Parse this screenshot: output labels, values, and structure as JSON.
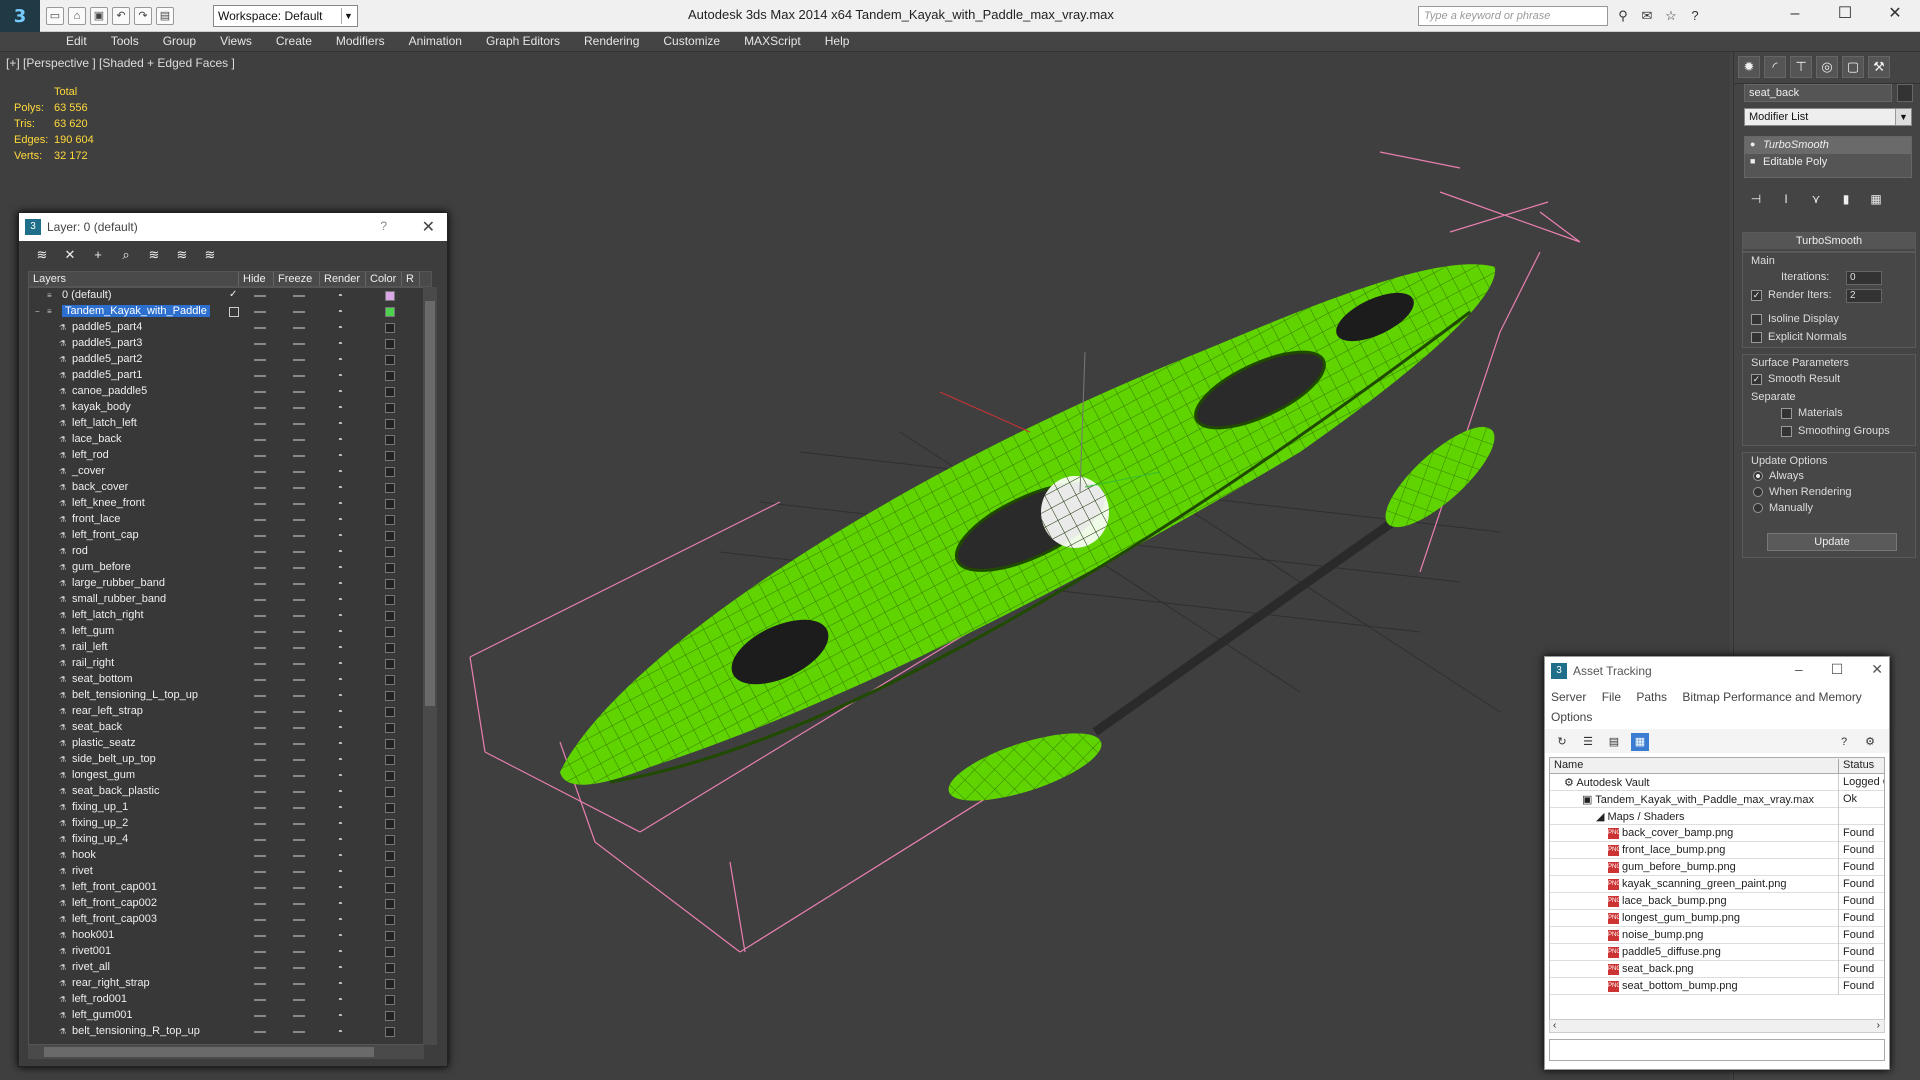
{
  "app": {
    "title": "Autodesk 3ds Max  2014 x64      Tandem_Kayak_with_Paddle_max_vray.max",
    "workspace": "Workspace: Default",
    "search_placeholder": "Type a keyword or phrase"
  },
  "menu": [
    "Edit",
    "Tools",
    "Group",
    "Views",
    "Create",
    "Modifiers",
    "Animation",
    "Graph Editors",
    "Rendering",
    "Customize",
    "MAXScript",
    "Help"
  ],
  "viewport": {
    "label": "[+] [Perspective ] [Shaded + Edged Faces ]",
    "stats": {
      "header": "Total",
      "rows": [
        {
          "label": "Polys:",
          "value": "63 556"
        },
        {
          "label": "Tris:",
          "value": "63 620"
        },
        {
          "label": "Edges:",
          "value": "190 604"
        },
        {
          "label": "Verts:",
          "value": "32 172"
        }
      ]
    },
    "kayak_color": "#5fd400",
    "bbox_color": "#e87fb0"
  },
  "command_panel": {
    "object_name": "seat_back",
    "modifier_list": "Modifier List",
    "stack": [
      "TurboSmooth",
      "Editable Poly"
    ],
    "rollout_title": "TurboSmooth",
    "main_title": "Main",
    "iterations_label": "Iterations:",
    "iterations_value": "0",
    "render_iters_label": "Render Iters:",
    "render_iters_value": "2",
    "isoline": "Isoline Display",
    "explicit_normals": "Explicit Normals",
    "surface_title": "Surface Parameters",
    "smooth_result": "Smooth Result",
    "separate": "Separate",
    "materials": "Materials",
    "smoothing_groups": "Smoothing Groups",
    "update_title": "Update Options",
    "always": "Always",
    "when_rendering": "When Rendering",
    "manually": "Manually",
    "update_button": "Update"
  },
  "layer_window": {
    "title": "Layer: 0 (default)",
    "columns": [
      "Layers",
      "Hide",
      "Freeze",
      "Render",
      "Color",
      "R"
    ],
    "default_layer": "0 (default)",
    "selected_layer": "Tandem_Kayak_with_Paddle",
    "objects": [
      "paddle5_part4",
      "paddle5_part3",
      "paddle5_part2",
      "paddle5_part1",
      "canoe_paddle5",
      "kayak_body",
      "left_latch_left",
      "lace_back",
      "left_rod",
      "_cover",
      "back_cover",
      "left_knee_front",
      "front_lace",
      "left_front_cap",
      "rod",
      "gum_before",
      "large_rubber_band",
      "small_rubber_band",
      "left_latch_right",
      "left_gum",
      "rail_left",
      "rail_right",
      "seat_bottom",
      "belt_tensioning_L_top_up",
      "rear_left_strap",
      "seat_back",
      "plastic_seatz",
      "side_belt_up_top",
      "longest_gum",
      "seat_back_plastic",
      "fixing_up_1",
      "fixing_up_2",
      "fixing_up_4",
      "hook",
      "rivet",
      "left_front_cap001",
      "left_front_cap002",
      "left_front_cap003",
      "hook001",
      "rivet001",
      "rivet_all",
      "rear_right_strap",
      "left_rod001",
      "left_gum001",
      "belt_tensioning_R_top_up"
    ]
  },
  "asset_window": {
    "title": "Asset Tracking",
    "menu": [
      "Server",
      "File",
      "Paths",
      "Bitmap Performance and Memory",
      "Options"
    ],
    "columns": [
      "Name",
      "Status"
    ],
    "rows": [
      {
        "name": "Autodesk Vault",
        "status": "Logged O",
        "indent": 1
      },
      {
        "name": "Tandem_Kayak_with_Paddle_max_vray.max",
        "status": "Ok",
        "indent": 2
      },
      {
        "name": "Maps / Shaders",
        "status": "",
        "indent": 3
      },
      {
        "name": "back_cover_bamp.png",
        "status": "Found",
        "indent": 4
      },
      {
        "name": "front_lace_bump.png",
        "status": "Found",
        "indent": 4
      },
      {
        "name": "gum_before_bump.png",
        "status": "Found",
        "indent": 4
      },
      {
        "name": "kayak_scanning_green_paint.png",
        "status": "Found",
        "indent": 4
      },
      {
        "name": "lace_back_bump.png",
        "status": "Found",
        "indent": 4
      },
      {
        "name": "longest_gum_bump.png",
        "status": "Found",
        "indent": 4
      },
      {
        "name": "noise_bump.png",
        "status": "Found",
        "indent": 4
      },
      {
        "name": "paddle5_diffuse.png",
        "status": "Found",
        "indent": 4
      },
      {
        "name": "seat_back.png",
        "status": "Found",
        "indent": 4
      },
      {
        "name": "seat_bottom_bump.png",
        "status": "Found",
        "indent": 4
      }
    ]
  }
}
